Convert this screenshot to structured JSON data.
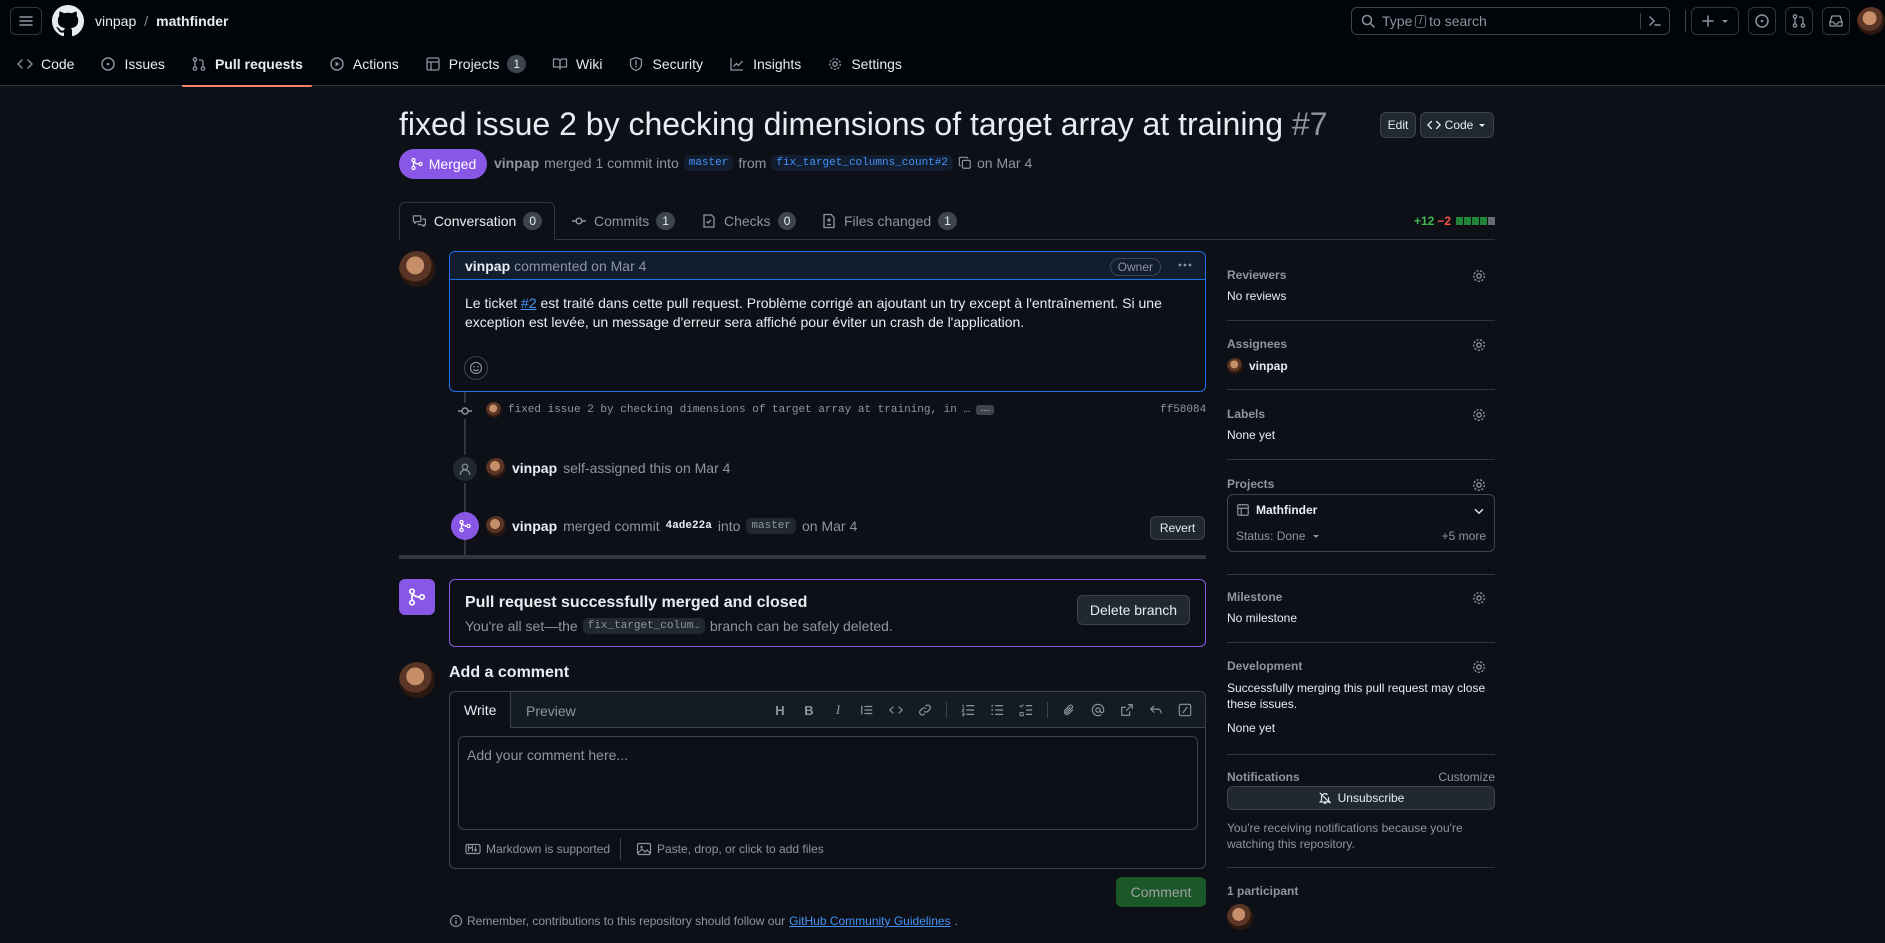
{
  "header": {
    "owner": "vinpap",
    "separator": "/",
    "repo": "mathfinder",
    "search_pre": "Type",
    "search_key": "/",
    "search_post": "to search"
  },
  "repo_tabs": [
    {
      "label": "Code",
      "icon": "code-icon"
    },
    {
      "label": "Issues",
      "icon": "issue-icon"
    },
    {
      "label": "Pull requests",
      "icon": "pull-request-icon",
      "active": true
    },
    {
      "label": "Actions",
      "icon": "play-icon"
    },
    {
      "label": "Projects",
      "icon": "table-icon",
      "count": "1"
    },
    {
      "label": "Wiki",
      "icon": "book-icon"
    },
    {
      "label": "Security",
      "icon": "shield-icon"
    },
    {
      "label": "Insights",
      "icon": "graph-icon"
    },
    {
      "label": "Settings",
      "icon": "gear-icon"
    }
  ],
  "pr": {
    "title": "fixed issue 2 by checking dimensions of target array at training",
    "number": "#7",
    "edit_label": "Edit",
    "code_label": "Code",
    "state": "Merged",
    "author": "vinpap",
    "merged_text": "merged 1 commit into",
    "base_branch": "master",
    "from_text": "from",
    "head_branch": "fix_target_columns_count#2",
    "date_text": "on Mar 4"
  },
  "pr_tabs": [
    {
      "label": "Conversation",
      "count": "0"
    },
    {
      "label": "Commits",
      "count": "1"
    },
    {
      "label": "Checks",
      "count": "0"
    },
    {
      "label": "Files changed",
      "count": "1"
    }
  ],
  "diffstat": {
    "additions": "+12",
    "deletions": "−2"
  },
  "comment": {
    "author": "vinpap",
    "meta": "commented on Mar 4",
    "role": "Owner",
    "body_pre": "Le ticket",
    "body_link": "#2",
    "body_line1": "est traité dans cette pull request. Problème corrigé an ajoutant un try except à l'entraînement. Si une",
    "body_line2": "exception est levée, un message d'erreur sera affiché pour éviter un crash de l'application."
  },
  "timeline": {
    "commit_msg": "fixed issue 2 by checking dimensions of target array at training, in …",
    "commit_sha": "ff58084",
    "assign_user": "vinpap",
    "assign_text": "self-assigned this on Mar 4",
    "merge_user": "vinpap",
    "merge_text": "merged commit",
    "merge_sha": "4ade22a",
    "merge_into": "into",
    "merge_branch": "master",
    "merge_date": "on Mar 4",
    "revert_label": "Revert"
  },
  "merge_box": {
    "title": "Pull request successfully merged and closed",
    "text_pre": "You're all set—the",
    "branch": "fix_target_colum…",
    "text_post": "branch can be safely deleted.",
    "button": "Delete branch"
  },
  "add_comment": {
    "heading": "Add a comment",
    "write_tab": "Write",
    "preview_tab": "Preview",
    "placeholder": "Add your comment here...",
    "markdown_note": "Markdown is supported",
    "attach_note": "Paste, drop, or click to add files",
    "submit": "Comment",
    "footer_pre": "Remember, contributions to this repository should follow our",
    "footer_link": "GitHub Community Guidelines",
    "footer_post": "."
  },
  "sidebar": {
    "reviewers": {
      "heading": "Reviewers",
      "value": "No reviews"
    },
    "assignees": {
      "heading": "Assignees",
      "user": "vinpap"
    },
    "labels": {
      "heading": "Labels",
      "value": "None yet"
    },
    "projects": {
      "heading": "Projects",
      "name": "Mathfinder",
      "status": "Status: Done",
      "more": "+5 more"
    },
    "milestone": {
      "heading": "Milestone",
      "value": "No milestone"
    },
    "development": {
      "heading": "Development",
      "text": "Successfully merging this pull request may close these issues.",
      "value": "None yet"
    },
    "notifications": {
      "heading": "Notifications",
      "customize": "Customize",
      "button": "Unsubscribe",
      "note": "You're receiving notifications because you're watching this repository."
    },
    "participants": {
      "heading": "1 participant"
    }
  },
  "colors": {
    "accent_merged": "#8957e5",
    "link": "#4493f8",
    "success": "#238636",
    "tab_underline": "#f78166"
  }
}
